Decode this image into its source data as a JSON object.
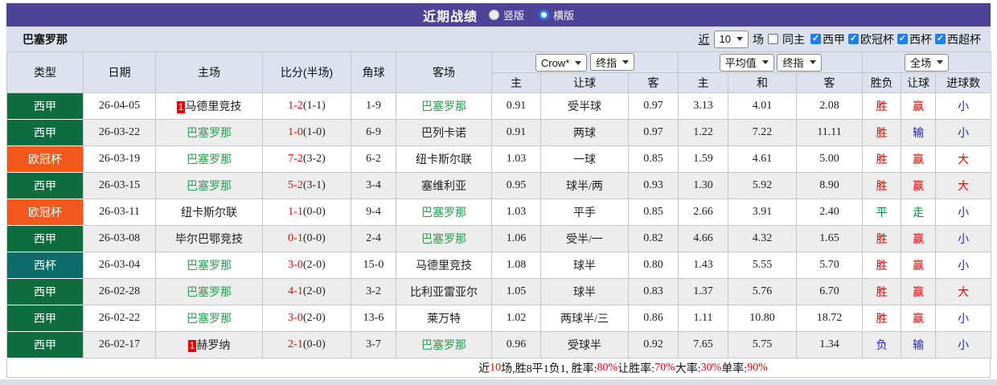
{
  "title_bar": {
    "title": "近期战绩",
    "radio_vertical_label": "竖版",
    "radio_horizontal_label": "横版",
    "selected_layout": "横版"
  },
  "filter_bar": {
    "team": "巴塞罗那",
    "near_label": "近",
    "matches_count": "10",
    "matches_label": "场",
    "same_home_label": "同主",
    "leagues": [
      "西甲",
      "欧冠杯",
      "西杯",
      "西超杯"
    ]
  },
  "controls": {
    "bookmaker": "Crow*",
    "handicap_stage": "终指",
    "europe_avg": "平均值",
    "europe_stage": "终指",
    "scope": "全场"
  },
  "table": {
    "headers_left": [
      "类型",
      "日期",
      "主场",
      "比分(半场)",
      "角球",
      "客场"
    ],
    "headers_sub": [
      "主",
      "让球",
      "客",
      "主",
      "和",
      "客",
      "胜负",
      "让球",
      "进球数"
    ],
    "rows": [
      {
        "league": "西甲",
        "date": "26-04-05",
        "home_badge": "1",
        "home": "马德里竞技",
        "score": "1-2",
        "half": "(1-1)",
        "corner": "1-9",
        "away_badge": "",
        "away": "巴塞罗那",
        "let": [
          "0.91",
          "受半球",
          "0.97"
        ],
        "euro": [
          "3.13",
          "4.01",
          "2.08"
        ],
        "result": [
          "胜",
          "赢",
          "小"
        ]
      },
      {
        "league": "西甲",
        "date": "26-03-22",
        "home_badge": "",
        "home": "巴塞罗那",
        "score": "1-0",
        "half": "(1-0)",
        "corner": "6-9",
        "away_badge": "",
        "away": "巴列卡诺",
        "let": [
          "0.91",
          "两球",
          "0.97"
        ],
        "euro": [
          "1.22",
          "7.22",
          "11.11"
        ],
        "result": [
          "胜",
          "输",
          "小"
        ]
      },
      {
        "league": "欧冠杯",
        "date": "26-03-19",
        "home_badge": "",
        "home": "巴塞罗那",
        "score": "7-2",
        "half": "(3-2)",
        "corner": "6-2",
        "away_badge": "",
        "away": "纽卡斯尔联",
        "let": [
          "1.03",
          "一球",
          "0.85"
        ],
        "euro": [
          "1.59",
          "4.61",
          "5.00"
        ],
        "result": [
          "胜",
          "赢",
          "大"
        ]
      },
      {
        "league": "西甲",
        "date": "26-03-15",
        "home_badge": "",
        "home": "巴塞罗那",
        "score": "5-2",
        "half": "(3-1)",
        "corner": "3-4",
        "away_badge": "",
        "away": "塞维利亚",
        "let": [
          "0.95",
          "球半/两",
          "0.93"
        ],
        "euro": [
          "1.30",
          "5.92",
          "8.90"
        ],
        "result": [
          "胜",
          "赢",
          "大"
        ]
      },
      {
        "league": "欧冠杯",
        "date": "26-03-11",
        "home_badge": "",
        "home": "纽卡斯尔联",
        "score": "1-1",
        "half": "(0-0)",
        "corner": "9-4",
        "away_badge": "",
        "away": "巴塞罗那",
        "let": [
          "1.03",
          "平手",
          "0.85"
        ],
        "euro": [
          "2.66",
          "3.91",
          "2.40"
        ],
        "result": [
          "平",
          "走",
          "小"
        ]
      },
      {
        "league": "西甲",
        "date": "26-03-08",
        "home_badge": "",
        "home": "毕尔巴鄂竞技",
        "score": "0-1",
        "half": "(0-0)",
        "corner": "2-4",
        "away_badge": "",
        "away": "巴塞罗那",
        "let": [
          "1.06",
          "受半/一",
          "0.82"
        ],
        "euro": [
          "4.66",
          "4.32",
          "1.65"
        ],
        "result": [
          "胜",
          "赢",
          "小"
        ]
      },
      {
        "league": "西杯",
        "date": "26-03-04",
        "home_badge": "",
        "home": "巴塞罗那",
        "score": "3-0",
        "half": "(2-0)",
        "corner": "15-0",
        "away_badge": "",
        "away": "马德里竞技",
        "let": [
          "1.08",
          "球半",
          "0.80"
        ],
        "euro": [
          "1.43",
          "5.55",
          "5.70"
        ],
        "result": [
          "胜",
          "赢",
          "小"
        ]
      },
      {
        "league": "西甲",
        "date": "26-02-28",
        "home_badge": "",
        "home": "巴塞罗那",
        "score": "4-1",
        "half": "(2-0)",
        "corner": "3-2",
        "away_badge": "",
        "away": "比利亚雷亚尔",
        "let": [
          "1.05",
          "球半",
          "0.83"
        ],
        "euro": [
          "1.37",
          "5.76",
          "6.70"
        ],
        "result": [
          "胜",
          "赢",
          "大"
        ]
      },
      {
        "league": "西甲",
        "date": "26-02-22",
        "home_badge": "",
        "home": "巴塞罗那",
        "score": "3-0",
        "half": "(2-0)",
        "corner": "13-6",
        "away_badge": "",
        "away": "莱万特",
        "let": [
          "1.02",
          "两球半/三",
          "0.86"
        ],
        "euro": [
          "1.11",
          "10.80",
          "18.72"
        ],
        "result": [
          "胜",
          "赢",
          "小"
        ]
      },
      {
        "league": "西甲",
        "date": "26-02-17",
        "home_badge": "1",
        "home": "赫罗纳",
        "score": "2-1",
        "half": "(0-0)",
        "corner": "3-7",
        "away_badge": "",
        "away": "巴塞罗那",
        "let": [
          "0.96",
          "受球半",
          "0.92"
        ],
        "euro": [
          "7.65",
          "5.75",
          "1.34"
        ],
        "result": [
          "负",
          "输",
          "小"
        ]
      }
    ]
  },
  "footer": {
    "segments": [
      {
        "text": "近",
        "red": false
      },
      {
        "text": "10",
        "red": true
      },
      {
        "text": "场,胜8平1负1, 胜率:",
        "red": false
      },
      {
        "text": "80%",
        "red": true
      },
      {
        "text": " 让胜率:",
        "red": false
      },
      {
        "text": "70%",
        "red": true
      },
      {
        "text": " 大率:",
        "red": false
      },
      {
        "text": "30%",
        "red": true
      },
      {
        "text": " 单率:",
        "red": false
      },
      {
        "text": "90%",
        "red": true
      }
    ]
  },
  "colors": {
    "titlebar_bg": "#4F4299",
    "league": {
      "西甲": "#0E6C3E",
      "欧冠杯": "#F4581C",
      "西杯": "#0C6C6C"
    },
    "result": {
      "胜": "#E60000",
      "平": "#0A8A3C",
      "负": "#2222CE",
      "赢": "#E60000",
      "走": "#0A8A3C",
      "输": "#2222CE",
      "大": "#E60000",
      "小": "#2222CE"
    },
    "highlight_team": {
      "name": "巴塞罗那",
      "color": "#2D9C4C"
    }
  }
}
